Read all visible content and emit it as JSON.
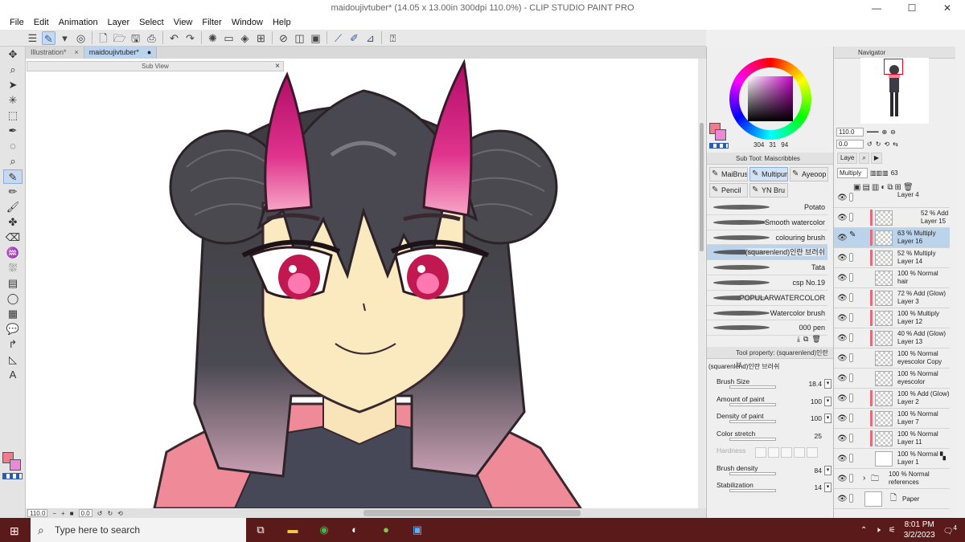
{
  "window": {
    "title": "maidoujivtuber* (14.05 x 13.00in 300dpi 110.0%) - CLIP STUDIO PAINT PRO",
    "min": "—",
    "max": "☐",
    "close": "✕"
  },
  "menu": [
    "File",
    "Edit",
    "Animation",
    "Layer",
    "Select",
    "View",
    "Filter",
    "Window",
    "Help"
  ],
  "tabs": [
    {
      "label": "Illustration*",
      "close": "×"
    },
    {
      "label": "maidoujivtuber*",
      "close": "●"
    }
  ],
  "subview": {
    "title": "Sub View",
    "close": "×"
  },
  "status": {
    "zoom": "110.0",
    "rotation": "0.0"
  },
  "color_panel": {
    "values": [
      "304",
      "31",
      "94"
    ]
  },
  "subtool": {
    "title": "Sub Tool: Maiscribbles",
    "groups": [
      "MaiBrus",
      "Multipur",
      "Ayeoop",
      "Pencil",
      "YN Bru"
    ],
    "brushes": [
      "Potato",
      "Smooth watercolor",
      "colouring brush",
      "(squarenlend)인란 브러쉬",
      "Tata",
      "csp No.19",
      "POPULARWATERCOLOR",
      "Watercolor brush",
      "000 pen"
    ]
  },
  "tool_property": {
    "title": "Tool property: (squarenlend)인란 브",
    "subtitle": "(squarenlend)인란 브러쉬",
    "props": [
      {
        "label": "Brush Size",
        "value": "18.4"
      },
      {
        "label": "Amount of paint",
        "value": "100"
      },
      {
        "label": "Density of paint",
        "value": "100"
      },
      {
        "label": "Color stretch",
        "value": "25"
      },
      {
        "label": "Hardness",
        "value": ""
      },
      {
        "label": "Brush density",
        "value": "84"
      },
      {
        "label": "Stabilization",
        "value": "14"
      }
    ]
  },
  "navigator": {
    "title": "Navigator",
    "zoom": "110.0",
    "rotation": "0.0"
  },
  "layer_panel": {
    "tab": "Laye",
    "blend": "Multiply",
    "opacity": "63",
    "layers": [
      {
        "mode": "",
        "name": "Layer 4"
      },
      {
        "mode": "52 % Add",
        "name": "Layer 15"
      },
      {
        "mode": "63 % Multiply",
        "name": "Layer 16"
      },
      {
        "mode": "52 % Multiply",
        "name": "Layer 14"
      },
      {
        "mode": "100 % Normal",
        "name": "hair"
      },
      {
        "mode": "72 % Add (Glow)",
        "name": "Layer 3"
      },
      {
        "mode": "100 % Multiply",
        "name": "Layer 12"
      },
      {
        "mode": "40 % Add (Glow)",
        "name": "Layer 13"
      },
      {
        "mode": "100 % Normal",
        "name": "eyescolor Copy"
      },
      {
        "mode": "100 % Normal",
        "name": "eyescolor"
      },
      {
        "mode": "100 % Add (Glow)",
        "name": "Layer 2"
      },
      {
        "mode": "100 % Normal",
        "name": "Layer 7"
      },
      {
        "mode": "100 % Normal",
        "name": "Layer 11"
      },
      {
        "mode": "100 % Normal",
        "name": "Layer 1"
      },
      {
        "mode": "100 % Normal",
        "name": "references"
      },
      {
        "mode": "",
        "name": "Paper"
      }
    ]
  },
  "taskbar": {
    "search_placeholder": "Type here to search",
    "time": "8:01 PM",
    "date": "3/2/2023",
    "notif": "4"
  }
}
